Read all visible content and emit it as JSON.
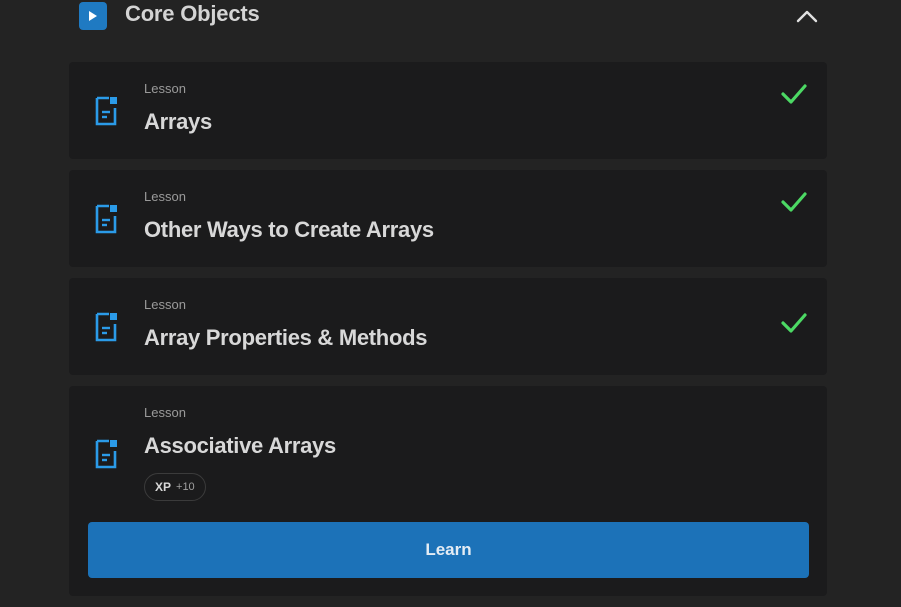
{
  "section": {
    "title": "Core Objects",
    "icon": "play-icon",
    "collapse_icon": "chevron-up-icon"
  },
  "lessons": [
    {
      "kind": "Lesson",
      "title": "Arrays",
      "completed": true
    },
    {
      "kind": "Lesson",
      "title": "Other Ways to Create Arrays",
      "completed": true
    },
    {
      "kind": "Lesson",
      "title": "Array Properties & Methods",
      "completed": true
    },
    {
      "kind": "Lesson",
      "title": "Associative Arrays",
      "completed": false,
      "xp": {
        "label": "XP",
        "value": "+10"
      },
      "action_label": "Learn"
    }
  ],
  "colors": {
    "accent": "#1c72b8",
    "check": "#4cd964",
    "lesson_icon": "#2b9be8",
    "background": "#232323",
    "card": "#1b1b1c"
  }
}
